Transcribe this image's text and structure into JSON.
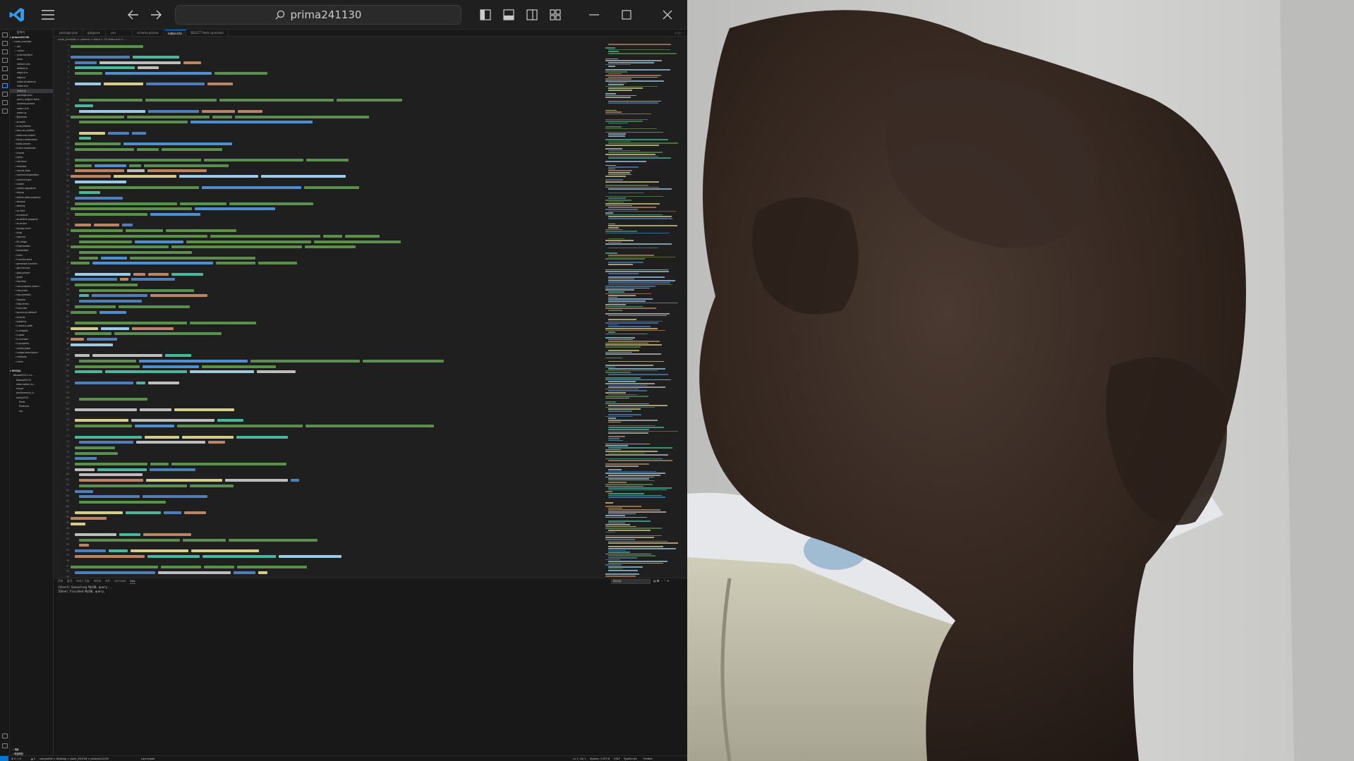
{
  "window": {
    "title": "prima241130",
    "command_center_text": "prima241130"
  },
  "sidebar": {
    "title": "탐색기",
    "open_folder": "prima241130",
    "tree": [
      {
        "label": "node_modules"
      },
      {
        "label": ".bin"
      },
      {
        "label": ".cache"
      },
      {
        "label": ".prisma\\client"
      },
      {
        "label": "deno"
      },
      {
        "label": "default.d.ts"
      },
      {
        "label": "default.js"
      },
      {
        "label": "edge.d.ts"
      },
      {
        "label": "edge.js"
      },
      {
        "label": "index-browser.js"
      },
      {
        "label": "index.d.ts"
      },
      {
        "label": "index.js"
      },
      {
        "label": "package.json"
      },
      {
        "label": "query_engine-wind..."
      },
      {
        "label": "schema.prisma"
      },
      {
        "label": "wasm.d.ts"
      },
      {
        "label": "wasm.js"
      },
      {
        "label": "@prisma"
      },
      {
        "label": "accepts"
      },
      {
        "label": "array-flatten"
      },
      {
        "label": "aws-ssl-profiles"
      },
      {
        "label": "balanced-match"
      },
      {
        "label": "binary-extensions"
      },
      {
        "label": "body-parser"
      },
      {
        "label": "brace-expansion"
      },
      {
        "label": "braces"
      },
      {
        "label": "bytes"
      },
      {
        "label": "call-bind"
      },
      {
        "label": "chokidar"
      },
      {
        "label": "concat-map"
      },
      {
        "label": "content-disposition"
      },
      {
        "label": "content-type"
      },
      {
        "label": "cookie"
      },
      {
        "label": "cookie-signature"
      },
      {
        "label": "debug"
      },
      {
        "label": "define-data-property"
      },
      {
        "label": "denque"
      },
      {
        "label": "destroy"
      },
      {
        "label": "ee-first"
      },
      {
        "label": "encodeurl"
      },
      {
        "label": "es-define-property"
      },
      {
        "label": "es-errors"
      },
      {
        "label": "escape-html"
      },
      {
        "label": "etag"
      },
      {
        "label": "express"
      },
      {
        "label": "fill-range"
      },
      {
        "label": "finalhandler"
      },
      {
        "label": "forwarded"
      },
      {
        "label": "fresh"
      },
      {
        "label": "function-bind"
      },
      {
        "label": "generate-function"
      },
      {
        "label": "get-intrinsic"
      },
      {
        "label": "glob-parent"
      },
      {
        "label": "gopd"
      },
      {
        "label": "has-flag"
      },
      {
        "label": "has-property-descri..."
      },
      {
        "label": "has-proto"
      },
      {
        "label": "has-symbols"
      },
      {
        "label": "hasown"
      },
      {
        "label": "http-errors"
      },
      {
        "label": "iconv-lite"
      },
      {
        "label": "ignore-by-default"
      },
      {
        "label": "inherits"
      },
      {
        "label": "ipaddr.js"
      },
      {
        "label": "is-binary-path"
      },
      {
        "label": "is-extglob"
      },
      {
        "label": "is-glob"
      },
      {
        "label": "is-number"
      },
      {
        "label": "is-property"
      },
      {
        "label": "media-typer"
      },
      {
        "label": "merge-descriptors"
      },
      {
        "label": "methods"
      },
      {
        "label": "mime"
      }
    ],
    "outline_section": "MYSQL",
    "outline_items": [
      {
        "label": "dbsosik2412.co..."
      },
      {
        "label": "Dbsosik2412"
      },
      {
        "label": "information_sc..."
      },
      {
        "label": "mysql"
      },
      {
        "label": "performance_s..."
      },
      {
        "label": "study2412"
      },
      {
        "label": "Posts"
      },
      {
        "label": "Products"
      },
      {
        "label": "sys"
      }
    ],
    "bottom_sections": [
      "개요",
      "타임라인"
    ]
  },
  "tabs": [
    {
      "label": "package.json"
    },
    {
      "label": "gitignore"
    },
    {
      "label": ".env"
    },
    {
      "label": "schema.prisma"
    },
    {
      "label": "index.d.ts"
    },
    {
      "label": "SELECT Posts (preview)"
    }
  ],
  "breadcrumb": "node_modules > .prisma > client > TS index.d.ts > ...",
  "editor": {
    "first_line": 1,
    "last_line": 128
  },
  "panel": {
    "tabs": [
      "문제",
      "출력",
      "디버그 콘솔",
      "터미널",
      "포트",
      "GITLENS",
      "SQL"
    ],
    "active_tab": "SQL",
    "select_value": "MySQL",
    "lines": [
      "[Start] Executing MySQL query...",
      "[Done] Finished MySQL query."
    ]
  },
  "statusbar": {
    "items": [
      "⊗ 0 ⚠ 0",
      "▲ 0",
      "userprofile > Desktop > sosik_250106 > prisma241130",
      "Launchpad",
      "Ln 1, Col 1",
      "Spaces: 2",
      "UTF-8",
      "CRLF",
      "TypeScript",
      "Prettier"
    ]
  },
  "colors": {
    "accent": "#0078d4",
    "editor_bg": "#1f1f1f",
    "titlebar_bg": "#1f1f1f"
  }
}
